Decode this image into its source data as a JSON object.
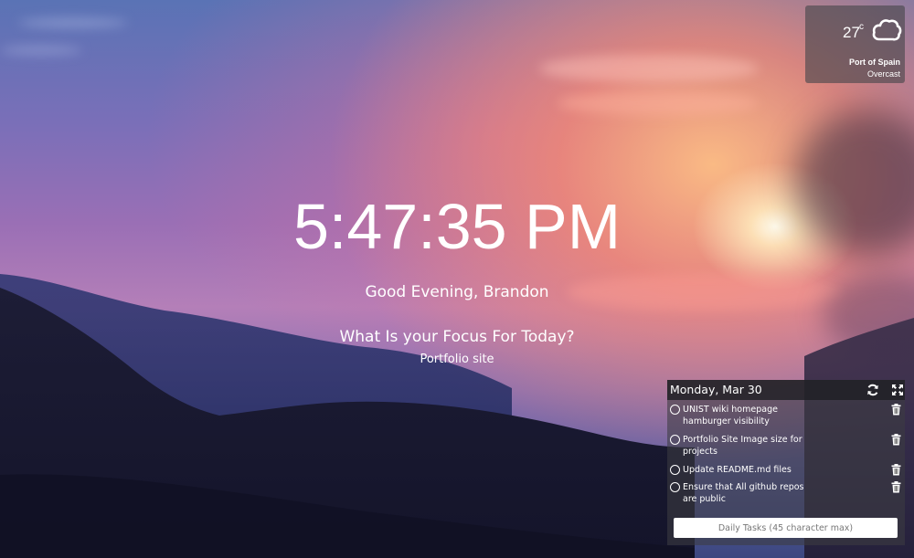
{
  "weather": {
    "temperature": "27",
    "unit": "c",
    "city": "Port of Spain",
    "condition": "Overcast",
    "icon": "cloud-icon"
  },
  "clock": {
    "time": "5:47:35 PM"
  },
  "greeting": "Good Evening, Brandon",
  "focus": {
    "question": "What Is your Focus For Today?",
    "answer": "Portfolio site"
  },
  "tasks": {
    "date": "Monday, Mar 30",
    "items": [
      {
        "label": "UNIST wiki homepage hamburger visibility"
      },
      {
        "label": "Portfolio Site Image size for projects"
      },
      {
        "label": "Update README.md files"
      },
      {
        "label": "Ensure that All github repos are public"
      }
    ],
    "input_placeholder": "Daily Tasks (45 character max)"
  }
}
